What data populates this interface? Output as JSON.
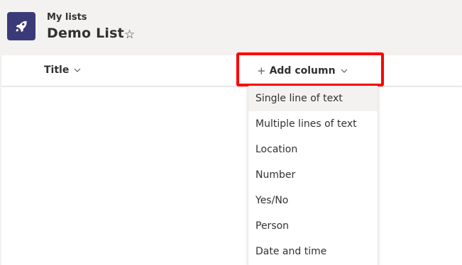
{
  "header": {
    "breadcrumb": "My lists",
    "title": "Demo List",
    "favorite_icon": "☆",
    "app_icon": "rocket-icon",
    "app_icon_color": "#3b3a78"
  },
  "columns": {
    "title_label": "Title",
    "add_column_label": "Add column",
    "add_icon": "+",
    "highlight_color": "#ff0000"
  },
  "menu": {
    "items": [
      {
        "label": "Single line of text",
        "selected": true
      },
      {
        "label": "Multiple lines of text",
        "selected": false
      },
      {
        "label": "Location",
        "selected": false
      },
      {
        "label": "Number",
        "selected": false
      },
      {
        "label": "Yes/No",
        "selected": false
      },
      {
        "label": "Person",
        "selected": false
      },
      {
        "label": "Date and time",
        "selected": false
      }
    ]
  }
}
